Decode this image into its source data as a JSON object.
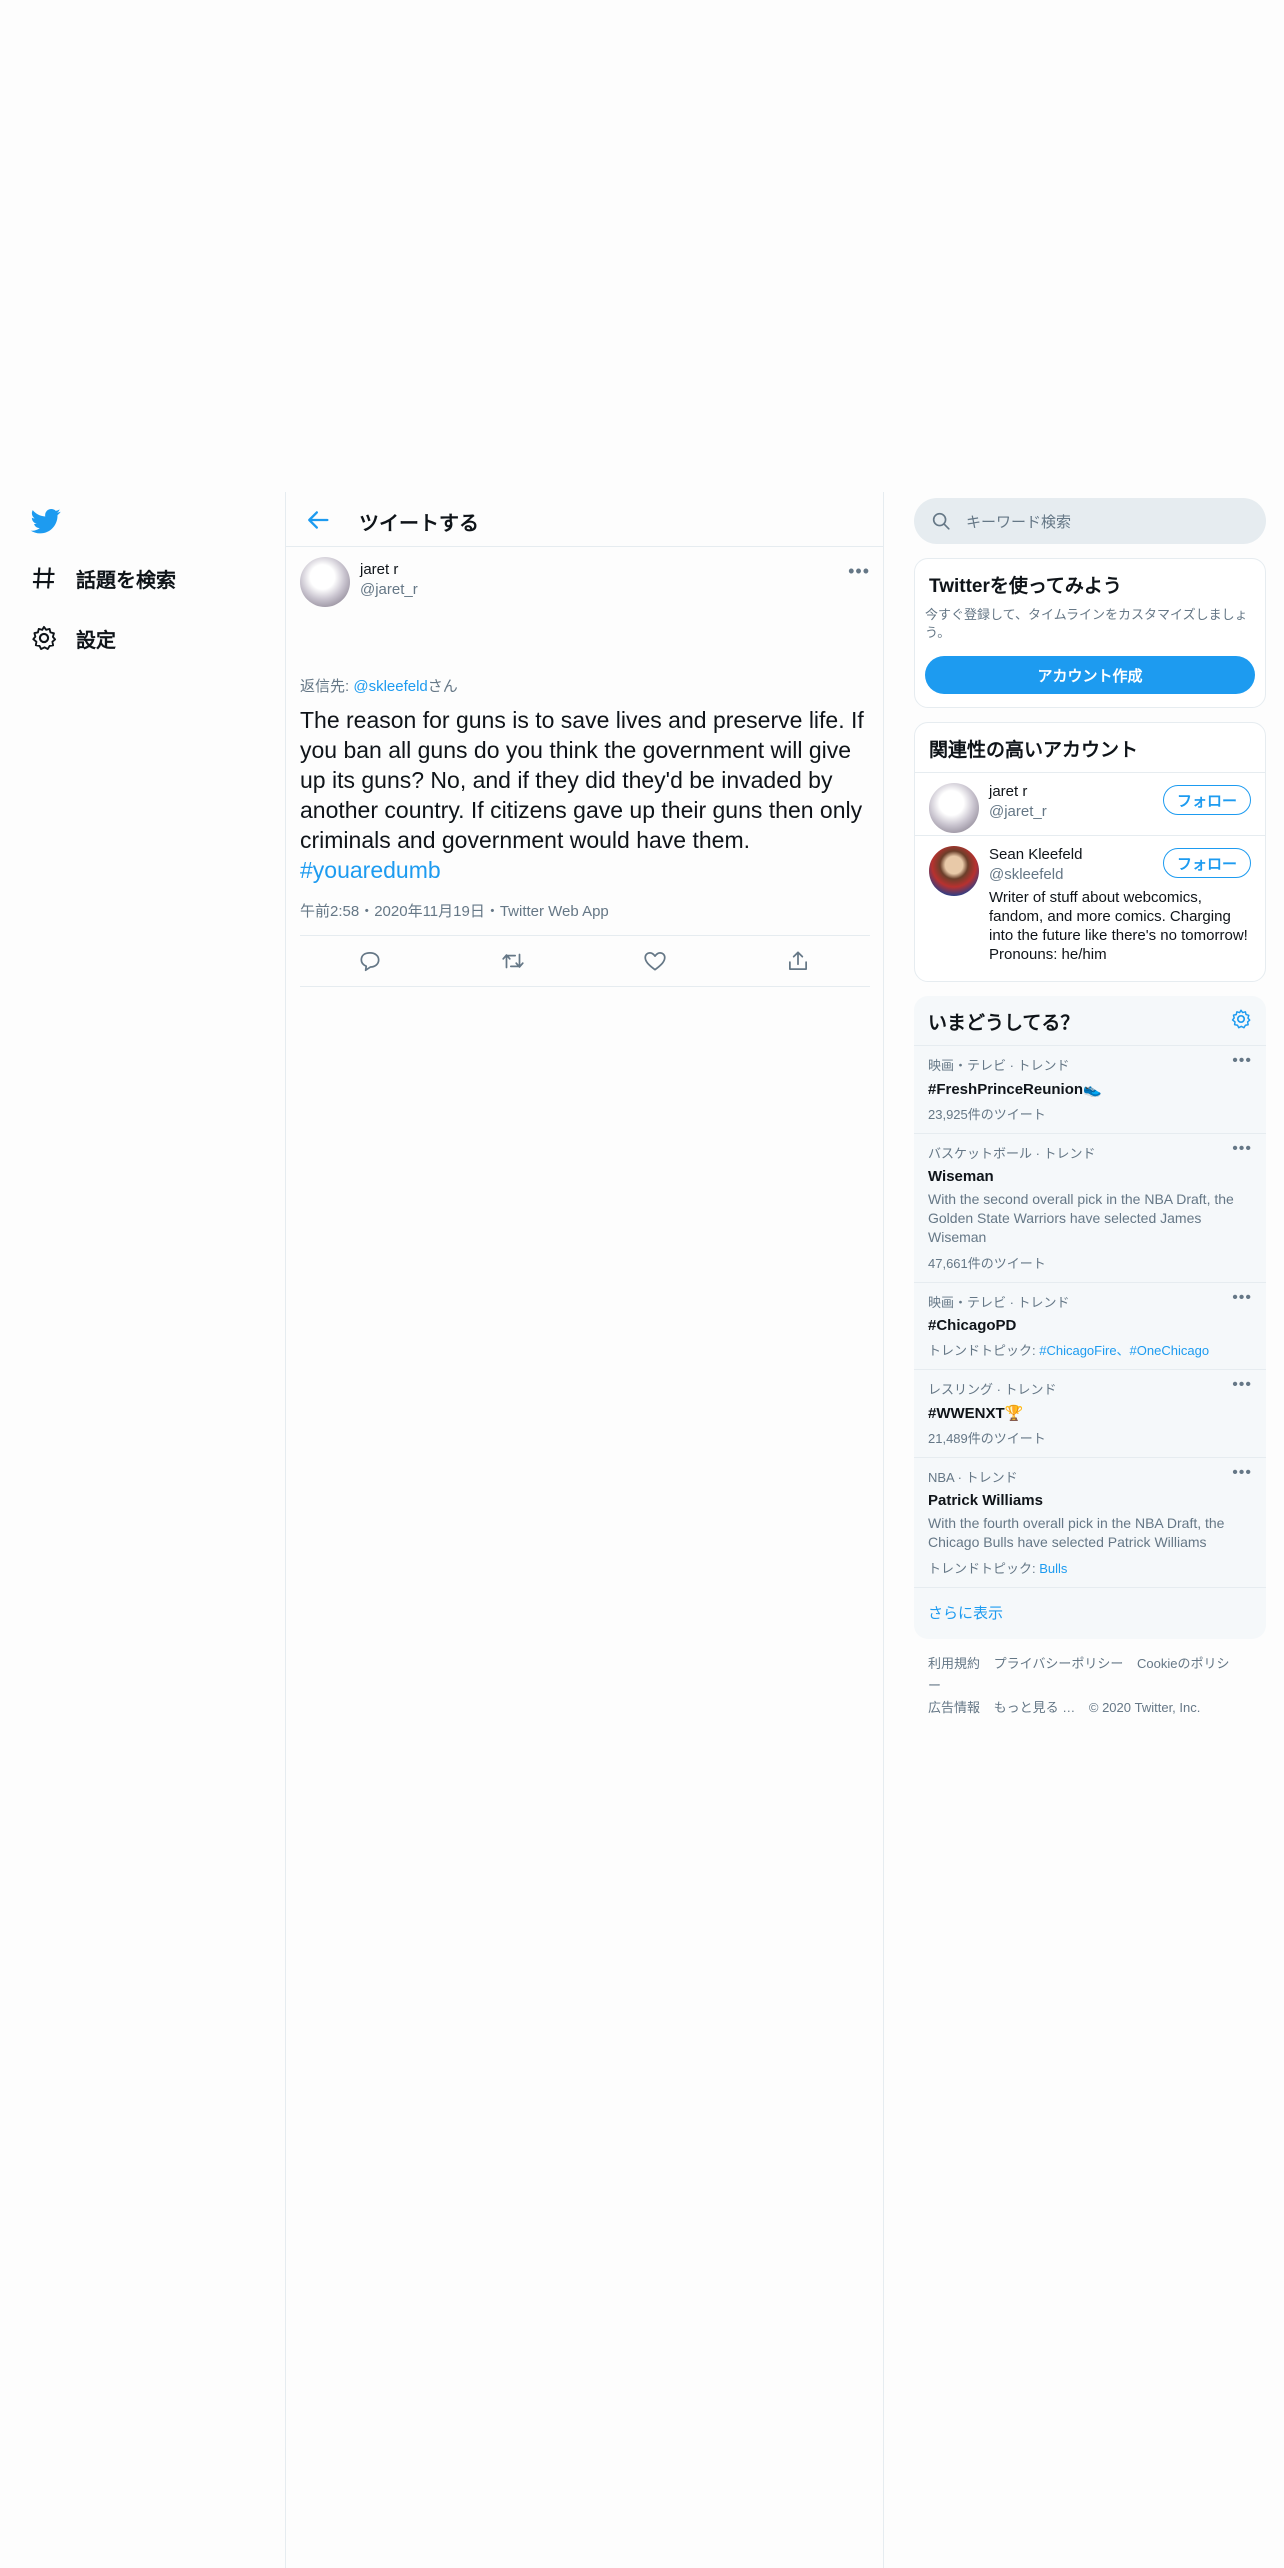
{
  "nav": {
    "logo_icon": "twitter-bird-icon",
    "explore_label": "話題を検索",
    "settings_label": "設定"
  },
  "header": {
    "title": "ツイートする"
  },
  "tweet": {
    "name": "jaret r",
    "handle": "@jaret_r",
    "reply_prefix": "返信先: ",
    "reply_to": "@skleefeld",
    "reply_suffix": "さん",
    "text": "The reason for guns is to save lives and preserve life. If you ban all guns do you think the government will give up its guns? No, and if they did they'd be invaded by another country. If citizens gave up their guns then only criminals and government would have them. ",
    "hashtag": "#youaredumb",
    "meta": "午前2:58・2020年11月19日・Twitter Web App"
  },
  "search": {
    "placeholder": "キーワード検索"
  },
  "signup": {
    "title": "Twitterを使ってみよう",
    "description": "今すぐ登録して、タイムラインをカスタマイズしましょう。",
    "button": "アカウント作成"
  },
  "related": {
    "title": "関連性の高いアカウント",
    "follow_label": "フォロー",
    "users": [
      {
        "name": "jaret r",
        "handle": "@jaret_r",
        "bio": ""
      },
      {
        "name": "Sean Kleefeld",
        "handle": "@skleefeld",
        "bio": "Writer of stuff about webcomics, fandom, and more comics. Charging into the future like there's no tomorrow! Pronouns: he/him"
      }
    ]
  },
  "trends": {
    "title": "いまどうしてる？",
    "items": [
      {
        "category": "映画・テレビ · トレンド",
        "name": "#FreshPrinceReunion",
        "emoji": "👟",
        "count": "23,925件のツイート"
      },
      {
        "category": "バスケットボール · トレンド",
        "name": "Wiseman",
        "description": "With the second overall pick in the NBA Draft, the Golden State Warriors have selected James Wiseman",
        "count": "47,661件のツイート"
      },
      {
        "category": "映画・テレビ · トレンド",
        "name": "#ChicagoPD",
        "topics_label": "トレンドトピック: ",
        "topics": "#ChicagoFire、#OneChicago"
      },
      {
        "category": "レスリング · トレンド",
        "name": "#WWENXT",
        "emoji": "🏆",
        "count": "21,489件のツイート"
      },
      {
        "category": "NBA · トレンド",
        "name": "Patrick Williams",
        "description": "With the fourth overall pick in the NBA Draft, the Chicago Bulls have selected Patrick Williams",
        "topics_label": "トレンドトピック: ",
        "topics": "Bulls"
      }
    ],
    "show_more": "さらに表示"
  },
  "footer": {
    "links": [
      "利用規約",
      "プライバシーポリシー",
      "Cookieのポリシー",
      "広告情報",
      "もっと見る …"
    ],
    "copyright": "© 2020 Twitter, Inc."
  }
}
